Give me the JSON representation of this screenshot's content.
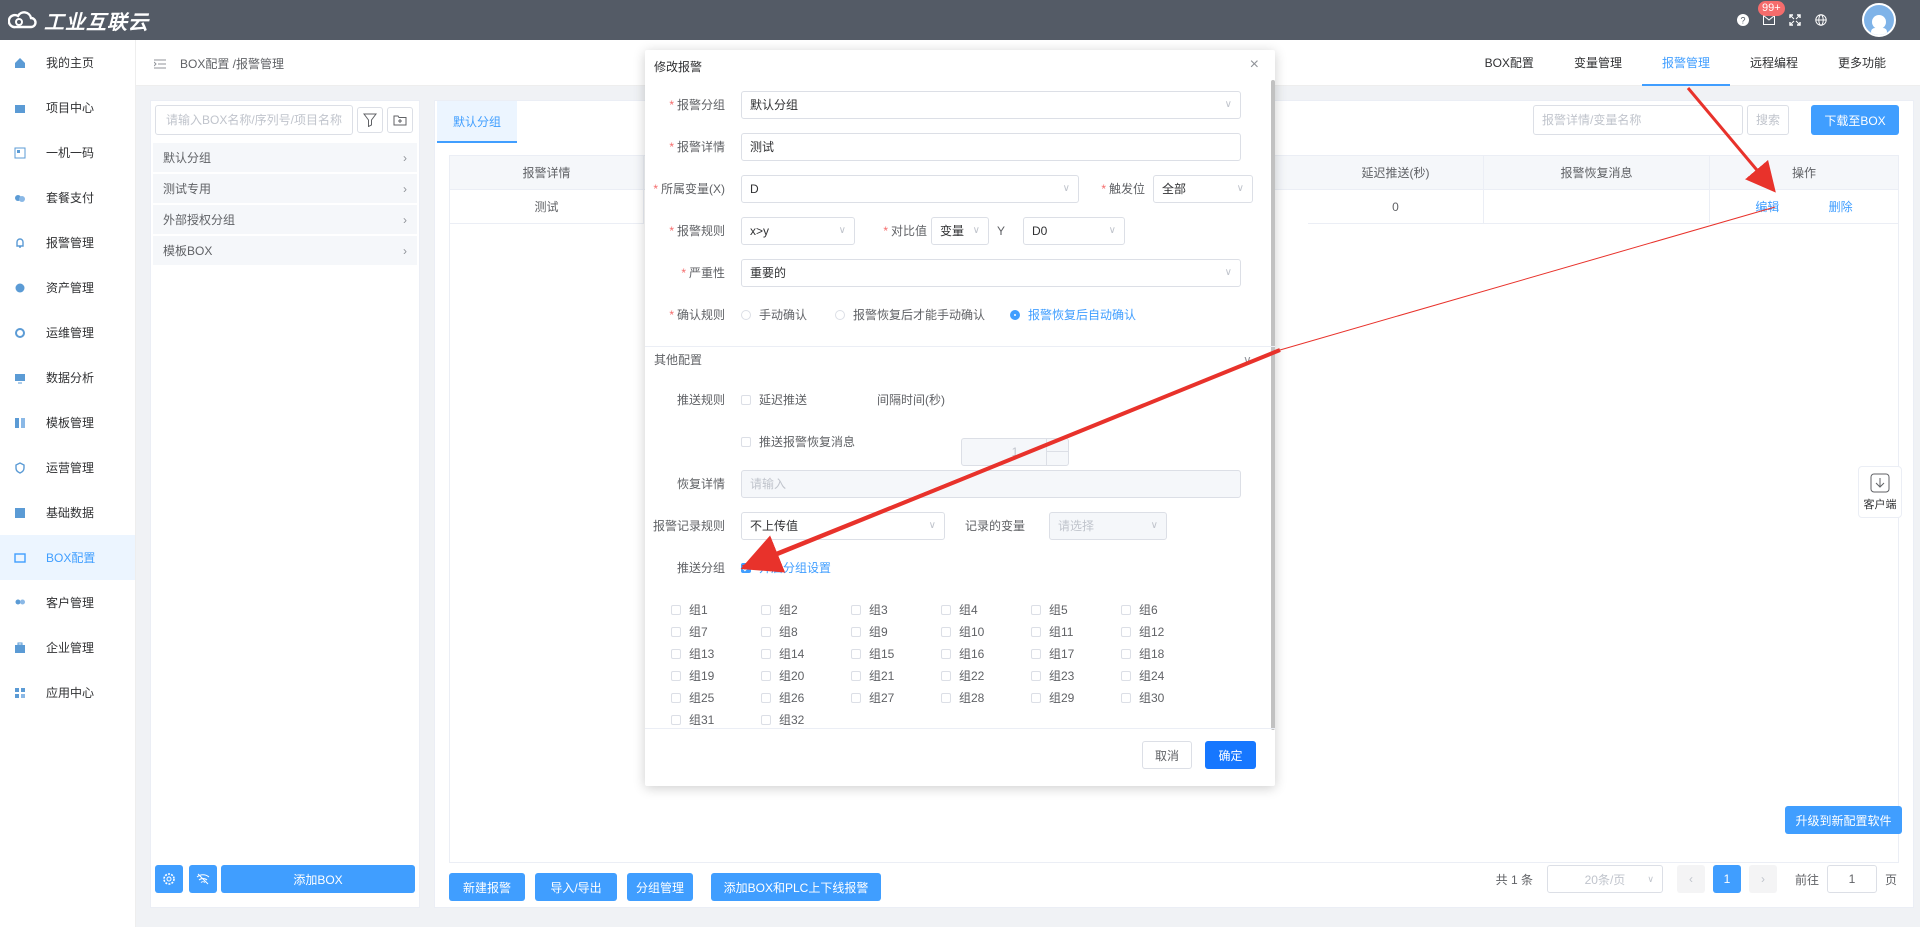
{
  "topbar": {
    "brand": "工业互联云",
    "badge": "99+"
  },
  "sidebar": {
    "items": [
      {
        "label": "我的主页",
        "icon": "home-icon"
      },
      {
        "label": "项目中心",
        "icon": "project-icon"
      },
      {
        "label": "一机一码",
        "icon": "qrcode-icon"
      },
      {
        "label": "套餐支付",
        "icon": "payment-icon"
      },
      {
        "label": "报警管理",
        "icon": "bell-icon"
      },
      {
        "label": "资产管理",
        "icon": "asset-icon"
      },
      {
        "label": "运维管理",
        "icon": "maintenance-icon"
      },
      {
        "label": "数据分析",
        "icon": "chart-icon"
      },
      {
        "label": "模板管理",
        "icon": "template-icon"
      },
      {
        "label": "运营管理",
        "icon": "shield-icon"
      },
      {
        "label": "基础数据",
        "icon": "data-icon"
      },
      {
        "label": "BOX配置",
        "icon": "box-icon"
      },
      {
        "label": "客户管理",
        "icon": "users-icon"
      },
      {
        "label": "企业管理",
        "icon": "briefcase-icon"
      },
      {
        "label": "应用中心",
        "icon": "apps-icon"
      }
    ]
  },
  "header": {
    "breadcrumb": "BOX配置 /报警管理",
    "tabs": [
      "BOX配置",
      "变量管理",
      "报警管理",
      "远程编程",
      "更多功能"
    ]
  },
  "left": {
    "search_placeholder": "请输入BOX名称/序列号/项目名称",
    "groups": [
      "默认分组",
      "测试专用",
      "外部授权分组",
      "模板BOX"
    ],
    "add_box": "添加BOX"
  },
  "main": {
    "tab": "默认分组",
    "search_placeholder": "报警详情/变量名称",
    "search_btn": "搜索",
    "download_btn": "下载至BOX",
    "columns": [
      "报警详情",
      "延迟推送(秒)",
      "报警恢复消息",
      "操作"
    ],
    "row": {
      "detail": "测试",
      "delay": "0",
      "edit": "编辑",
      "delete": "删除"
    },
    "upgrade_btn": "升级到新配置软件",
    "bottom_btns": [
      "新建报警",
      "导入/导出",
      "分组管理",
      "添加BOX和PLC上下线报警"
    ],
    "pager": {
      "total": "共 1 条",
      "size": "20条/页",
      "page": "1",
      "goto": "前往",
      "goto_val": "1",
      "unit": "页"
    }
  },
  "client_service": "客户端",
  "dialog": {
    "title": "修改报警",
    "group_label": "报警分组",
    "group_val": "默认分组",
    "detail_label": "报警详情",
    "detail_val": "测试",
    "var_label": "所属变量(X)",
    "var_val": "D",
    "trigger_label": "触发位",
    "trigger_val": "全部",
    "rule_label": "报警规则",
    "rule_val": "x>y",
    "compare_label": "对比值",
    "compare_val": "变量",
    "y_label": "Y",
    "y_val": "D0",
    "severity_label": "严重性",
    "severity_val": "重要的",
    "confirm_label": "确认规则",
    "confirm_opts": [
      "手动确认",
      "报警恢复后才能手动确认",
      "报警恢复后自动确认"
    ],
    "other_label": "其他配置",
    "push_label": "推送规则",
    "delay_push": "延迟推送",
    "interval_label": "间隔时间(秒)",
    "interval_val": "1",
    "push_restore": "推送报警恢复消息",
    "restore_label": "恢复详情",
    "restore_ph": "请输入",
    "record_label": "报警记录规则",
    "record_val": "不上传值",
    "record_var_label": "记录的变量",
    "record_var_ph": "请选择",
    "push_group_label": "推送分组",
    "enable_group": "开启分组设置",
    "groups": [
      "组1",
      "组2",
      "组3",
      "组4",
      "组5",
      "组6",
      "组7",
      "组8",
      "组9",
      "组10",
      "组11",
      "组12",
      "组13",
      "组14",
      "组15",
      "组16",
      "组17",
      "组18",
      "组19",
      "组20",
      "组21",
      "组22",
      "组23",
      "组24",
      "组25",
      "组26",
      "组27",
      "组28",
      "组29",
      "组30",
      "组31",
      "组32"
    ],
    "cancel": "取消",
    "ok": "确定"
  },
  "colors": {
    "primary": "#409eff",
    "arrow": "#e8322b",
    "topbar": "#545b66"
  }
}
